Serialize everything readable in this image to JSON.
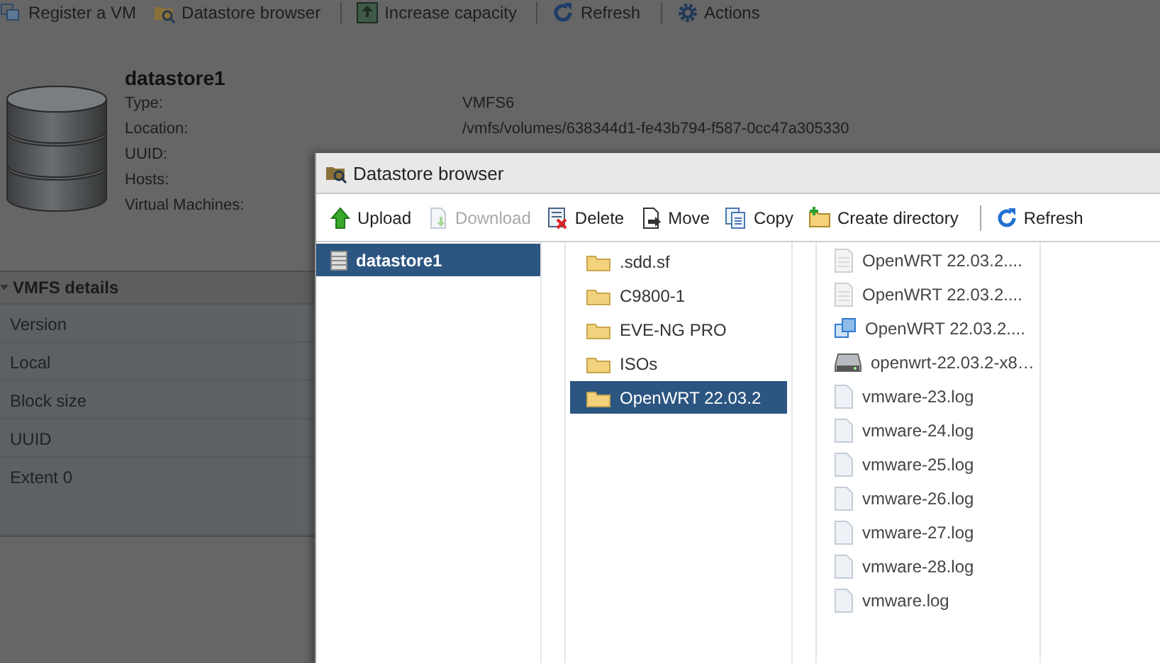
{
  "toolbar": [
    {
      "label": "Register a VM"
    },
    {
      "label": "Datastore browser"
    },
    {
      "label": "Increase capacity"
    },
    {
      "label": "Refresh"
    },
    {
      "label": "Actions"
    }
  ],
  "datastore": {
    "name": "datastore1",
    "properties": [
      {
        "label": "Type:",
        "value": "VMFS6"
      },
      {
        "label": "Location:",
        "value": "/vmfs/volumes/638344d1-fe43b794-f587-0cc47a305330"
      },
      {
        "label": "UUID:"
      },
      {
        "label": "Hosts:"
      },
      {
        "label": "Virtual Machines:"
      }
    ]
  },
  "vmfs_details": {
    "title": "VMFS details",
    "expanded": true,
    "rows": [
      {
        "label": "Version"
      },
      {
        "label": "Local"
      },
      {
        "label": "Block size"
      },
      {
        "label": "UUID"
      },
      {
        "label": "Extent 0"
      }
    ]
  },
  "dialog": {
    "title": "Datastore browser",
    "toolbar": [
      {
        "label": "Upload",
        "disabled": false
      },
      {
        "label": "Download",
        "disabled": true
      },
      {
        "label": "Delete",
        "disabled": false
      },
      {
        "label": "Move",
        "disabled": false
      },
      {
        "label": "Copy",
        "disabled": false
      },
      {
        "label": "Create directory",
        "disabled": false
      },
      {
        "label": "Refresh",
        "disabled": false
      }
    ],
    "tree": [
      {
        "label": "datastore1",
        "selected": true
      }
    ],
    "folders": [
      {
        "label": ".sdd.sf",
        "selected": false
      },
      {
        "label": "C9800-1",
        "selected": false
      },
      {
        "label": "EVE-NG PRO",
        "selected": false
      },
      {
        "label": "ISOs",
        "selected": false
      },
      {
        "label": "OpenWRT 22.03.2",
        "selected": true
      }
    ],
    "files": [
      {
        "label": "OpenWRT 22.03.2....",
        "kind": "text"
      },
      {
        "label": "OpenWRT 22.03.2....",
        "kind": "text"
      },
      {
        "label": "OpenWRT 22.03.2....",
        "kind": "vmx"
      },
      {
        "label": "openwrt-22.03.2-x8…",
        "kind": "disk"
      },
      {
        "label": "vmware-23.log",
        "kind": "log"
      },
      {
        "label": "vmware-24.log",
        "kind": "log"
      },
      {
        "label": "vmware-25.log",
        "kind": "log"
      },
      {
        "label": "vmware-26.log",
        "kind": "log"
      },
      {
        "label": "vmware-27.log",
        "kind": "log"
      },
      {
        "label": "vmware-28.log",
        "kind": "log"
      },
      {
        "label": "vmware.log",
        "kind": "log"
      }
    ]
  }
}
